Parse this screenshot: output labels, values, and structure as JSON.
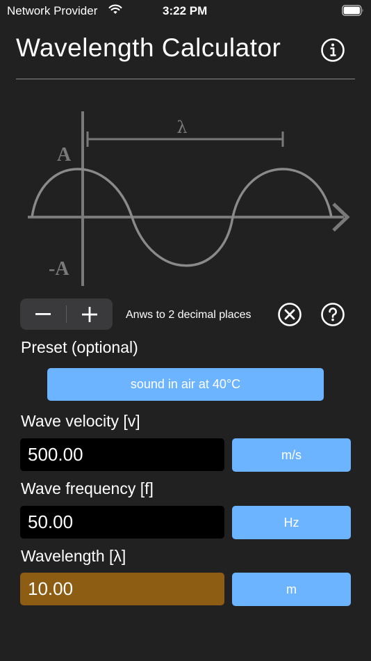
{
  "status_bar": {
    "carrier": "Network Provider",
    "time": "3:22 PM",
    "wifi_icon": "wifi-icon",
    "battery_icon": "battery-icon"
  },
  "header": {
    "title": "Wavelength Calculator",
    "info_icon": "info-icon"
  },
  "diagram": {
    "lambda_label": "λ",
    "amplitude_label": "A",
    "neg_amplitude_label": "-A",
    "stroke_color": "#7a7a7a"
  },
  "controls": {
    "decrease_symbol": "−",
    "increase_symbol": "+",
    "decimals_text": "Anws to 2 decimal places",
    "clear_icon": "clear-circle-x-icon",
    "help_icon": "help-question-icon"
  },
  "preset": {
    "label": "Preset (optional)",
    "button_label": "sound in air at 40°C"
  },
  "velocity": {
    "label": "Wave velocity [v]",
    "value": "500.00",
    "unit": "m/s"
  },
  "frequency": {
    "label": "Wave frequency [f]",
    "value": "50.00",
    "unit": "Hz"
  },
  "wavelength": {
    "label": "Wavelength [λ]",
    "value": "10.00",
    "unit": "m"
  },
  "colors": {
    "background": "#212121",
    "accent_button": "#6cb4ff",
    "input_background": "#000000",
    "result_background": "#8c5d13"
  }
}
